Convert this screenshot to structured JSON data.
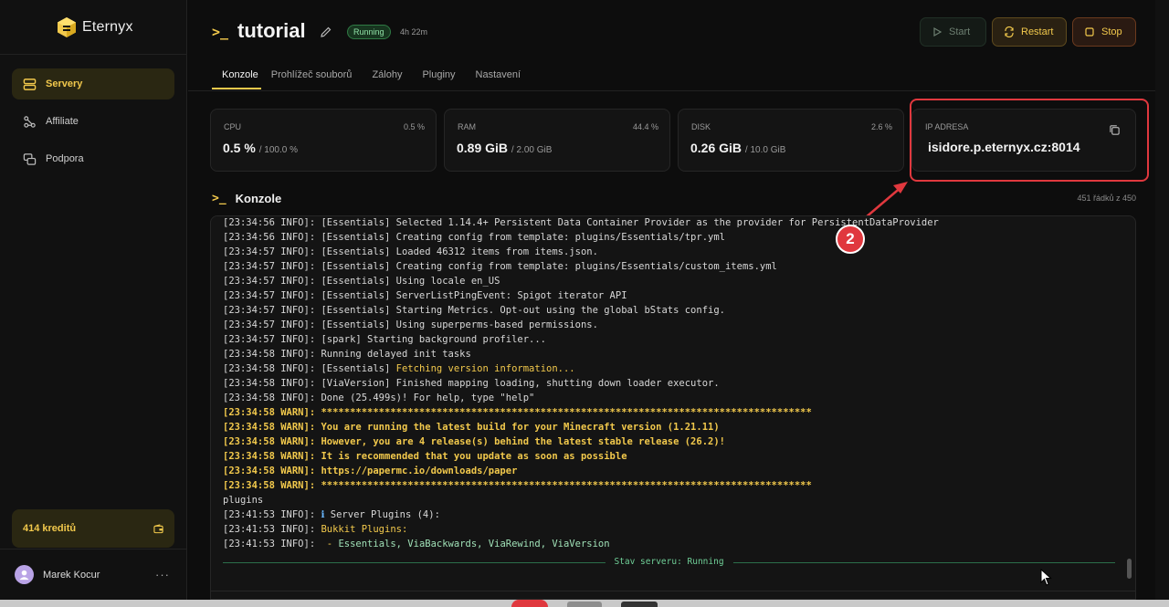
{
  "app": {
    "name": "Eternyx"
  },
  "sidebar": {
    "items": [
      {
        "label": "Servery",
        "icon": "server-icon",
        "active": true
      },
      {
        "label": "Affiliate",
        "icon": "affiliate-icon",
        "active": false
      },
      {
        "label": "Podpora",
        "icon": "support-icon",
        "active": false
      }
    ],
    "credits": "414 kreditů",
    "user": {
      "name": "Marek Kocur",
      "more": "···"
    }
  },
  "header": {
    "prompt": ">_",
    "title": "tutorial",
    "status": "Running",
    "uptime": "4h 22m",
    "buttons": {
      "start": "Start",
      "restart": "Restart",
      "stop": "Stop"
    }
  },
  "tabs": [
    "Konzole",
    "Prohlížeč souborů",
    "Zálohy",
    "Pluginy",
    "Nastavení"
  ],
  "stats": {
    "cpu": {
      "label": "CPU",
      "pct": "0.5 %",
      "value": "0.5 %",
      "max": "/ 100.0 %"
    },
    "ram": {
      "label": "RAM",
      "pct": "44.4 %",
      "value": "0.89 GiB",
      "max": "/ 2.00 GiB"
    },
    "disk": {
      "label": "DISK",
      "pct": "2.6 %",
      "value": "0.26 GiB",
      "max": "/ 10.0 GiB"
    },
    "ip": {
      "label": "IP ADRESA",
      "value": "isidore.p.eternyx.cz:8014"
    }
  },
  "annotation": {
    "number": "2"
  },
  "console": {
    "title": "Konzole",
    "prompt": ">_",
    "line_count": "451 řádků z 450",
    "status_line": "Stav serveru: Running",
    "lines": [
      {
        "prefix": "[23:34:56 INFO]: ",
        "text": "[Essentials] Selected 1.14.4+ Persistent Data Container Provider as the provider for PersistentDataProvider",
        "style": "normal"
      },
      {
        "prefix": "[23:34:56 INFO]: ",
        "text": "[Essentials] Creating config from template: plugins/Essentials/tpr.yml",
        "style": "normal"
      },
      {
        "prefix": "[23:34:57 INFO]: ",
        "text": "[Essentials] Loaded 46312 items from items.json.",
        "style": "normal"
      },
      {
        "prefix": "[23:34:57 INFO]: ",
        "text": "[Essentials] Creating config from template: plugins/Essentials/custom_items.yml",
        "style": "normal"
      },
      {
        "prefix": "[23:34:57 INFO]: ",
        "text": "[Essentials] Using locale en_US",
        "style": "normal"
      },
      {
        "prefix": "[23:34:57 INFO]: ",
        "text": "[Essentials] ServerListPingEvent: Spigot iterator API",
        "style": "normal"
      },
      {
        "prefix": "[23:34:57 INFO]: ",
        "text": "[Essentials] Starting Metrics. Opt-out using the global bStats config.",
        "style": "normal"
      },
      {
        "prefix": "[23:34:57 INFO]: ",
        "text": "[Essentials] Using superperms-based permissions.",
        "style": "normal"
      },
      {
        "prefix": "[23:34:57 INFO]: ",
        "text": "[spark] Starting background profiler...",
        "style": "normal"
      },
      {
        "prefix": "[23:34:58 INFO]: ",
        "text": "Running delayed init tasks",
        "style": "normal"
      },
      {
        "prefix": "[23:34:58 INFO]: ",
        "text": "[Essentials] ",
        "text2": "Fetching version information...",
        "style": "mixed-hl"
      },
      {
        "prefix": "[23:34:58 INFO]: ",
        "text": "[ViaVersion] Finished mapping loading, shutting down loader executor.",
        "style": "normal"
      },
      {
        "prefix": "[23:34:58 INFO]: ",
        "text": "Done (25.499s)! For help, type \"help\"",
        "style": "normal"
      },
      {
        "prefix": "[23:34:58 WARN]: ",
        "text": "*************************************************************************************",
        "style": "warn"
      },
      {
        "prefix": "[23:34:58 WARN]: ",
        "text": "You are running the latest build for your Minecraft version (1.21.11)",
        "style": "warn"
      },
      {
        "prefix": "[23:34:58 WARN]: ",
        "text": "However, you are 4 release(s) behind the latest stable release (26.2)!",
        "style": "warn"
      },
      {
        "prefix": "[23:34:58 WARN]: ",
        "text": "It is recommended that you update as soon as possible",
        "style": "warn"
      },
      {
        "prefix": "[23:34:58 WARN]: ",
        "text": "https://papermc.io/downloads/paper",
        "style": "warn"
      },
      {
        "prefix": "[23:34:58 WARN]: ",
        "text": "*************************************************************************************",
        "style": "warn"
      },
      {
        "prefix": "",
        "text": "plugins",
        "style": "normal"
      },
      {
        "prefix": "[23:41:53 INFO]: ",
        "text": "ℹ",
        "text2": " Server Plugins (4):",
        "style": "info-icon"
      },
      {
        "prefix": "[23:41:53 INFO]: ",
        "text": "Bukkit Plugins:",
        "style": "hl"
      },
      {
        "prefix": "[23:41:53 INFO]: ",
        "text": " - ",
        "text2": "Essentials, ViaBackwards, ViaRewind, ViaVersion",
        "style": "plugins"
      }
    ]
  }
}
